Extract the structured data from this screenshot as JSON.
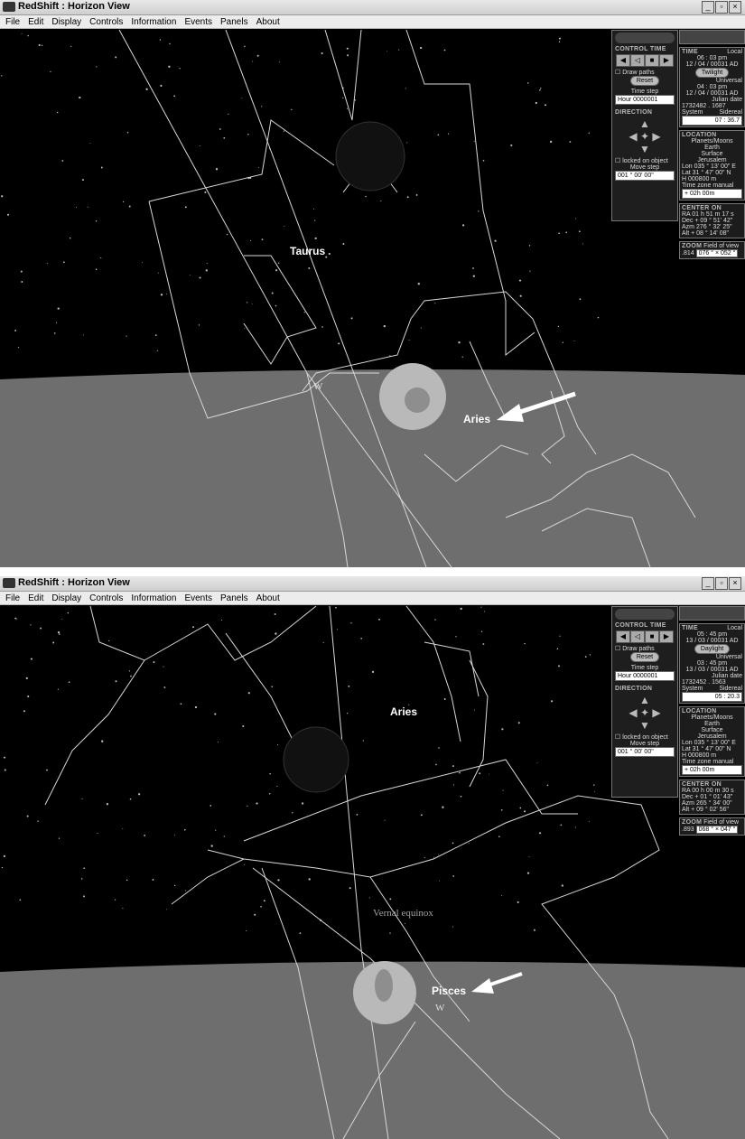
{
  "window1": {
    "title": "RedShift : Horizon View",
    "menu": [
      "File",
      "Edit",
      "Display",
      "Controls",
      "Information",
      "Events",
      "Panels",
      "About"
    ],
    "labels": {
      "constellation": "Taurus",
      "target": "Aries",
      "compass": "W"
    },
    "control": {
      "header": "CONTROL TIME",
      "draw_paths": "Draw paths",
      "reset": "Reset",
      "time_step_label": "Time step",
      "time_step": "Hour  0000001",
      "direction_header": "DIRECTION",
      "locked": "locked on object",
      "move_step_label": "Move step",
      "move_step": "001 ° 00' 00\""
    },
    "info": {
      "time_header": "TIME",
      "local": "Local",
      "local_time": "06 : 03 pm",
      "local_date": "12 / 04 / 00031 AD",
      "mode": "Twilight",
      "universal": "Universal",
      "ut_time": "04 : 03 pm",
      "ut_date": "12 / 04 / 00031 AD",
      "julian_label": "Julian date",
      "julian": "1732482 . 1687",
      "system": "System",
      "sidereal": "Sidereal",
      "sidereal_value": "07 : 36.7",
      "location_header": "LOCATION",
      "loc1": "Planets/Moons",
      "loc2": "Earth",
      "loc3": "Surface",
      "loc4": "Jerusalem",
      "lon": "Lon  035 ° 13' 00\" E",
      "lat": "Lat    31 ° 47' 00\" N",
      "h": "H      000800  m",
      "tz_label": "Time zone",
      "tz_manual": "manual",
      "tz": "+ 02h 00m",
      "center_header": "CENTER ON",
      "ra": "RA  01 h 51 m 17 s",
      "dec": "Dec  + 09 ° 51' 42\"",
      "azm": "Azm  276 ° 32' 25\"",
      "alt": "Alt   + 08 ° 14' 08\"",
      "zoom_header": "ZOOM",
      "fov_label": "Field of view",
      "zoom": ".814",
      "fov": "076 ° × 052 °"
    }
  },
  "window2": {
    "title": "RedShift : Horizon View",
    "menu": [
      "File",
      "Edit",
      "Display",
      "Controls",
      "Information",
      "Events",
      "Panels",
      "About"
    ],
    "labels": {
      "constellation": "Aries",
      "target": "Pisces",
      "equinox": "Vernal equinox",
      "compass": "W"
    },
    "control": {
      "header": "CONTROL TIME",
      "draw_paths": "Draw paths",
      "reset": "Reset",
      "time_step_label": "Time step",
      "time_step": "Hour  0000001",
      "direction_header": "DIRECTION",
      "locked": "locked on object",
      "move_step_label": "Move step",
      "move_step": "001 ° 00' 00\""
    },
    "info": {
      "time_header": "TIME",
      "local": "Local",
      "local_time": "05 : 45 pm",
      "local_date": "13 / 03 / 00031 AD",
      "mode": "Daylight",
      "universal": "Universal",
      "ut_time": "03 : 45 pm",
      "ut_date": "13 / 03 / 00031 AD",
      "julian_label": "Julian date",
      "julian": "1732452 . 1563",
      "system": "System",
      "sidereal": "Sidereal",
      "sidereal_value": "05 : 20.3",
      "location_header": "LOCATION",
      "loc1": "Planets/Moons",
      "loc2": "Earth",
      "loc3": "Surface",
      "loc4": "Jerusalem",
      "lon": "Lon  035 ° 13' 00\" E",
      "lat": "Lat    31 ° 47' 00\" N",
      "h": "H      000800  m",
      "tz_label": "Time zone",
      "tz_manual": "manual",
      "tz": "+ 02h 00m",
      "center_header": "CENTER ON",
      "ra": "RA  00 h 00 m 30 s",
      "dec": "Dec  + 01 ° 01' 43\"",
      "azm": "Azm  265 ° 34' 00\"",
      "alt": "Alt   + 09 ° 02' 56\"",
      "zoom_header": "ZOOM",
      "fov_label": "Field of view",
      "zoom": ".893",
      "fov": "068 ° × 047 °"
    }
  }
}
